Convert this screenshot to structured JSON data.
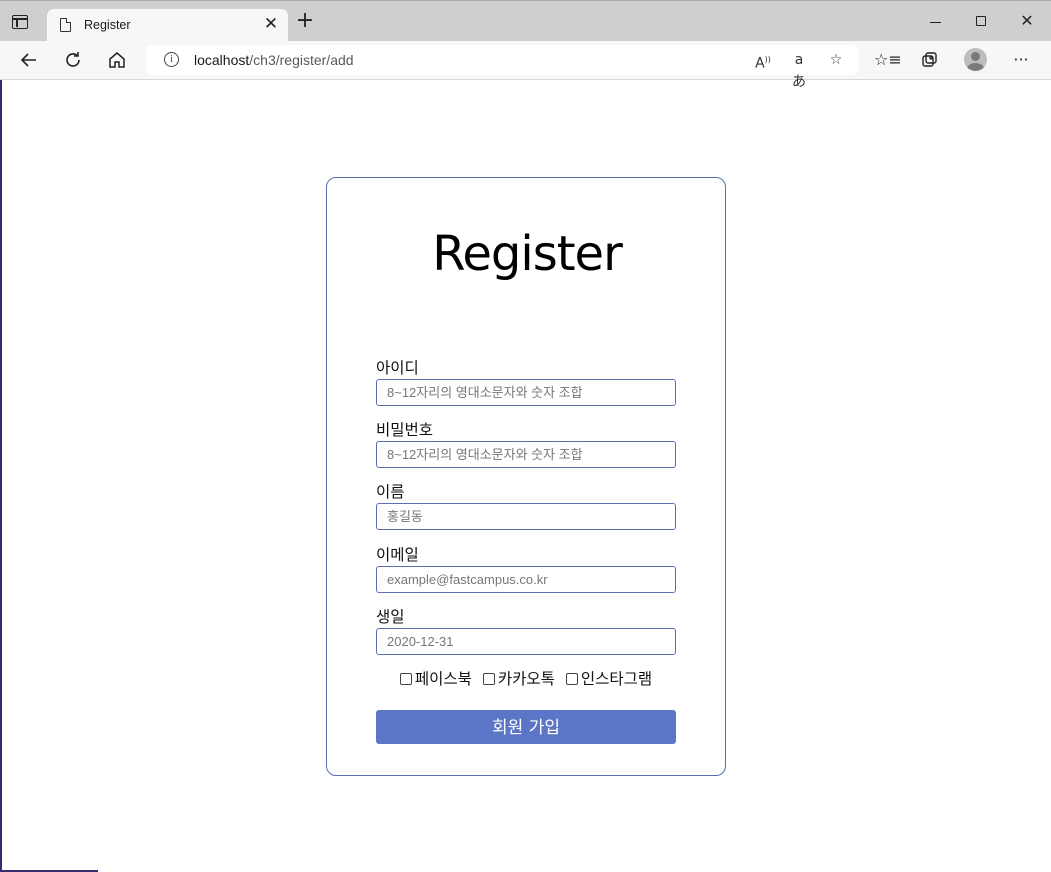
{
  "browser": {
    "tab_title": "Register",
    "url_host": "localhost",
    "url_path": "/ch3/register/add",
    "icons": [
      "tab-actions-icon",
      "page-icon",
      "close-icon",
      "plus-icon",
      "minimize-icon",
      "maximize-icon",
      "close-icon",
      "back-arrow-icon",
      "refresh-icon",
      "home-icon",
      "info-icon",
      "read-aloud-icon",
      "translate-icon",
      "add-favorite-icon",
      "favorites-icon",
      "collections-icon",
      "profile-icon",
      "more-icon"
    ]
  },
  "form": {
    "title": "Register",
    "fields": [
      {
        "label": "아이디",
        "placeholder": "8~12자리의 영대소문자와 숫자 조합",
        "value": ""
      },
      {
        "label": "비밀번호",
        "placeholder": "8~12자리의 영대소문자와 숫자 조합",
        "value": ""
      },
      {
        "label": "이름",
        "placeholder": "홍길동",
        "value": ""
      },
      {
        "label": "이메일",
        "placeholder": "example@fastcampus.co.kr",
        "value": ""
      },
      {
        "label": "생일",
        "placeholder": "2020-12-31",
        "value": ""
      }
    ],
    "checkboxes": [
      {
        "label": "페이스북",
        "checked": false
      },
      {
        "label": "카카오톡",
        "checked": false
      },
      {
        "label": "인스타그램",
        "checked": false
      }
    ],
    "submit_label": "회원 가입"
  },
  "colors": {
    "accent": "#5b76c6",
    "border": "#5a6fb0",
    "tabbar": "#cfcfcf",
    "toolbar": "#f7f7f7"
  }
}
